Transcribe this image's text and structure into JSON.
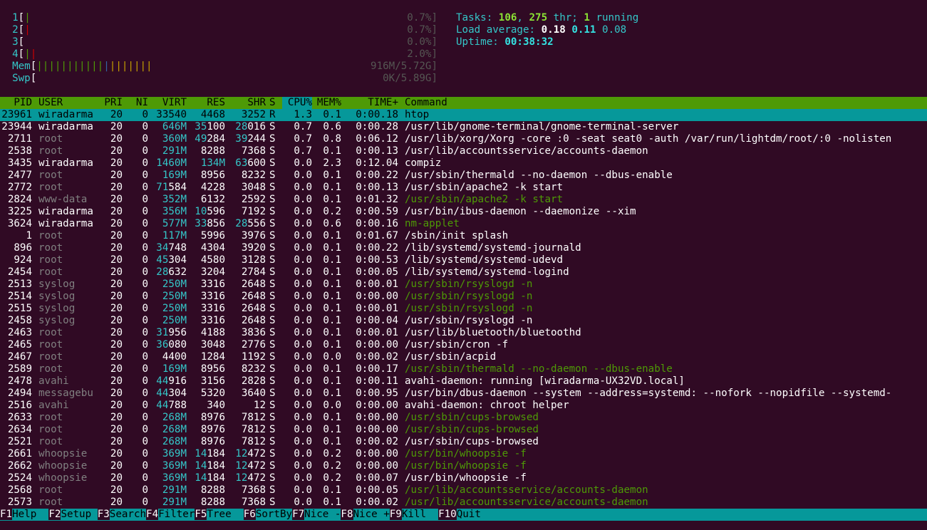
{
  "cpu_meters": [
    {
      "num": "1",
      "bars": [
        [
          "g",
          "|"
        ]
      ],
      "value": "0.7%]"
    },
    {
      "num": "2",
      "bars": [
        [
          "rd",
          "|"
        ]
      ],
      "value": "0.7%]"
    },
    {
      "num": "3",
      "bars": [],
      "value": "0.0%]"
    },
    {
      "num": "4",
      "bars": [
        [
          "g",
          "|"
        ],
        [
          "rd",
          "|"
        ]
      ],
      "value": "2.0%]"
    }
  ],
  "mem_meter": {
    "label": "Mem",
    "bars": [
      [
        "g",
        "|||||||||||"
      ],
      [
        "bl",
        "|"
      ],
      [
        "yl",
        "|||||||"
      ]
    ],
    "value": "916M/5.72G]"
  },
  "swp_meter": {
    "label": "Swp",
    "value": "0K/5.89G]"
  },
  "summary": {
    "tasks_label": "Tasks: ",
    "tasks": "106",
    "thr_sep": ", ",
    "thr": "275",
    "thr_label": " thr; ",
    "running": "1",
    "running_label": " running",
    "load_label": "Load average: ",
    "load1": "0.18",
    "load5": "0.11",
    "load15": "0.08",
    "uptime_label": "Uptime: ",
    "uptime": "00:38:32"
  },
  "columns": [
    "PID",
    "USER",
    "PRI",
    "NI",
    "VIRT",
    "RES",
    "SHR",
    "S",
    "CPU%",
    "MEM%",
    "TIME+",
    "Command"
  ],
  "sort_column": "CPU%",
  "processes": [
    {
      "pid": "23961",
      "user": "wiradarma",
      "pri": "20",
      "ni": "0",
      "virt": "33540",
      "res": "4468",
      "shr": "3252",
      "s": "R",
      "cpu": "1.3",
      "mem": "0.1",
      "time": "0:00.18",
      "cmd": "htop",
      "selected": true
    },
    {
      "pid": "23944",
      "user": "wiradarma",
      "pri": "20",
      "ni": "0",
      "virt": "646M",
      "res": "35100",
      "shr": "28016",
      "s": "S",
      "cpu": "0.7",
      "mem": "0.6",
      "time": "0:00.28",
      "cmd": "/usr/lib/gnome-terminal/gnome-terminal-server"
    },
    {
      "pid": "2711",
      "user": "root",
      "pri": "20",
      "ni": "0",
      "virt": "360M",
      "res": "49284",
      "shr": "39244",
      "s": "S",
      "cpu": "0.7",
      "mem": "0.8",
      "time": "0:06.12",
      "cmd": "/usr/lib/xorg/Xorg -core :0 -seat seat0 -auth /var/run/lightdm/root/:0 -nolisten"
    },
    {
      "pid": "2538",
      "user": "root",
      "pri": "20",
      "ni": "0",
      "virt": "291M",
      "res": "8288",
      "shr": "7368",
      "s": "S",
      "cpu": "0.7",
      "mem": "0.1",
      "time": "0:00.13",
      "cmd": "/usr/lib/accountsservice/accounts-daemon"
    },
    {
      "pid": "3435",
      "user": "wiradarma",
      "pri": "20",
      "ni": "0",
      "virt": "1460M",
      "res": "134M",
      "shr": "63600",
      "s": "S",
      "cpu": "0.0",
      "mem": "2.3",
      "time": "0:12.04",
      "cmd": "compiz"
    },
    {
      "pid": "2477",
      "user": "root",
      "pri": "20",
      "ni": "0",
      "virt": "169M",
      "res": "8956",
      "shr": "8232",
      "s": "S",
      "cpu": "0.0",
      "mem": "0.1",
      "time": "0:00.22",
      "cmd": "/usr/sbin/thermald --no-daemon --dbus-enable"
    },
    {
      "pid": "2772",
      "user": "root",
      "pri": "20",
      "ni": "0",
      "virt": "71584",
      "res": "4228",
      "shr": "3048",
      "s": "S",
      "cpu": "0.0",
      "mem": "0.1",
      "time": "0:00.13",
      "cmd": "/usr/sbin/apache2 -k start"
    },
    {
      "pid": "2824",
      "user": "www-data",
      "pri": "20",
      "ni": "0",
      "virt": "352M",
      "res": "6132",
      "shr": "2592",
      "s": "S",
      "cpu": "0.0",
      "mem": "0.1",
      "time": "0:01.32",
      "cmd": "/usr/sbin/apache2 -k start",
      "thread": true
    },
    {
      "pid": "3225",
      "user": "wiradarma",
      "pri": "20",
      "ni": "0",
      "virt": "356M",
      "res": "10596",
      "shr": "7192",
      "s": "S",
      "cpu": "0.0",
      "mem": "0.2",
      "time": "0:00.59",
      "cmd": "/usr/bin/ibus-daemon --daemonize --xim"
    },
    {
      "pid": "3624",
      "user": "wiradarma",
      "pri": "20",
      "ni": "0",
      "virt": "577M",
      "res": "33856",
      "shr": "28556",
      "s": "S",
      "cpu": "0.0",
      "mem": "0.6",
      "time": "0:00.16",
      "cmd": "nm-applet",
      "thread": true
    },
    {
      "pid": "1",
      "user": "root",
      "pri": "20",
      "ni": "0",
      "virt": "117M",
      "res": "5996",
      "shr": "3976",
      "s": "S",
      "cpu": "0.0",
      "mem": "0.1",
      "time": "0:01.67",
      "cmd": "/sbin/init splash"
    },
    {
      "pid": "896",
      "user": "root",
      "pri": "20",
      "ni": "0",
      "virt": "34748",
      "res": "4304",
      "shr": "3920",
      "s": "S",
      "cpu": "0.0",
      "mem": "0.1",
      "time": "0:00.22",
      "cmd": "/lib/systemd/systemd-journald"
    },
    {
      "pid": "924",
      "user": "root",
      "pri": "20",
      "ni": "0",
      "virt": "45304",
      "res": "4580",
      "shr": "3128",
      "s": "S",
      "cpu": "0.0",
      "mem": "0.1",
      "time": "0:00.53",
      "cmd": "/lib/systemd/systemd-udevd"
    },
    {
      "pid": "2454",
      "user": "root",
      "pri": "20",
      "ni": "0",
      "virt": "28632",
      "res": "3204",
      "shr": "2784",
      "s": "S",
      "cpu": "0.0",
      "mem": "0.1",
      "time": "0:00.05",
      "cmd": "/lib/systemd/systemd-logind"
    },
    {
      "pid": "2513",
      "user": "syslog",
      "pri": "20",
      "ni": "0",
      "virt": "250M",
      "res": "3316",
      "shr": "2648",
      "s": "S",
      "cpu": "0.0",
      "mem": "0.1",
      "time": "0:00.01",
      "cmd": "/usr/sbin/rsyslogd -n",
      "thread": true
    },
    {
      "pid": "2514",
      "user": "syslog",
      "pri": "20",
      "ni": "0",
      "virt": "250M",
      "res": "3316",
      "shr": "2648",
      "s": "S",
      "cpu": "0.0",
      "mem": "0.1",
      "time": "0:00.00",
      "cmd": "/usr/sbin/rsyslogd -n",
      "thread": true
    },
    {
      "pid": "2515",
      "user": "syslog",
      "pri": "20",
      "ni": "0",
      "virt": "250M",
      "res": "3316",
      "shr": "2648",
      "s": "S",
      "cpu": "0.0",
      "mem": "0.1",
      "time": "0:00.01",
      "cmd": "/usr/sbin/rsyslogd -n",
      "thread": true
    },
    {
      "pid": "2458",
      "user": "syslog",
      "pri": "20",
      "ni": "0",
      "virt": "250M",
      "res": "3316",
      "shr": "2648",
      "s": "S",
      "cpu": "0.0",
      "mem": "0.1",
      "time": "0:00.04",
      "cmd": "/usr/sbin/rsyslogd -n"
    },
    {
      "pid": "2463",
      "user": "root",
      "pri": "20",
      "ni": "0",
      "virt": "31956",
      "res": "4188",
      "shr": "3836",
      "s": "S",
      "cpu": "0.0",
      "mem": "0.1",
      "time": "0:00.01",
      "cmd": "/usr/lib/bluetooth/bluetoothd"
    },
    {
      "pid": "2465",
      "user": "root",
      "pri": "20",
      "ni": "0",
      "virt": "36080",
      "res": "3048",
      "shr": "2776",
      "s": "S",
      "cpu": "0.0",
      "mem": "0.1",
      "time": "0:00.00",
      "cmd": "/usr/sbin/cron -f"
    },
    {
      "pid": "2467",
      "user": "root",
      "pri": "20",
      "ni": "0",
      "virt": "4400",
      "res": "1284",
      "shr": "1192",
      "s": "S",
      "cpu": "0.0",
      "mem": "0.0",
      "time": "0:00.02",
      "cmd": "/usr/sbin/acpid"
    },
    {
      "pid": "2589",
      "user": "root",
      "pri": "20",
      "ni": "0",
      "virt": "169M",
      "res": "8956",
      "shr": "8232",
      "s": "S",
      "cpu": "0.0",
      "mem": "0.1",
      "time": "0:00.17",
      "cmd": "/usr/sbin/thermald --no-daemon --dbus-enable",
      "thread": true
    },
    {
      "pid": "2478",
      "user": "avahi",
      "pri": "20",
      "ni": "0",
      "virt": "44916",
      "res": "3156",
      "shr": "2828",
      "s": "S",
      "cpu": "0.0",
      "mem": "0.1",
      "time": "0:00.11",
      "cmd": "avahi-daemon: running [wiradarma-UX32VD.local]"
    },
    {
      "pid": "2494",
      "user": "messagebu",
      "pri": "20",
      "ni": "0",
      "virt": "44304",
      "res": "5320",
      "shr": "3640",
      "s": "S",
      "cpu": "0.0",
      "mem": "0.1",
      "time": "0:00.95",
      "cmd": "/usr/bin/dbus-daemon --system --address=systemd: --nofork --nopidfile --systemd-"
    },
    {
      "pid": "2516",
      "user": "avahi",
      "pri": "20",
      "ni": "0",
      "virt": "44788",
      "res": "340",
      "shr": "12",
      "s": "S",
      "cpu": "0.0",
      "mem": "0.0",
      "time": "0:00.00",
      "cmd": "avahi-daemon: chroot helper"
    },
    {
      "pid": "2633",
      "user": "root",
      "pri": "20",
      "ni": "0",
      "virt": "268M",
      "res": "8976",
      "shr": "7812",
      "s": "S",
      "cpu": "0.0",
      "mem": "0.1",
      "time": "0:00.00",
      "cmd": "/usr/sbin/cups-browsed",
      "thread": true
    },
    {
      "pid": "2634",
      "user": "root",
      "pri": "20",
      "ni": "0",
      "virt": "268M",
      "res": "8976",
      "shr": "7812",
      "s": "S",
      "cpu": "0.0",
      "mem": "0.1",
      "time": "0:00.00",
      "cmd": "/usr/sbin/cups-browsed",
      "thread": true
    },
    {
      "pid": "2521",
      "user": "root",
      "pri": "20",
      "ni": "0",
      "virt": "268M",
      "res": "8976",
      "shr": "7812",
      "s": "S",
      "cpu": "0.0",
      "mem": "0.1",
      "time": "0:00.02",
      "cmd": "/usr/sbin/cups-browsed"
    },
    {
      "pid": "2661",
      "user": "whoopsie",
      "pri": "20",
      "ni": "0",
      "virt": "369M",
      "res": "14184",
      "shr": "12472",
      "s": "S",
      "cpu": "0.0",
      "mem": "0.2",
      "time": "0:00.00",
      "cmd": "/usr/bin/whoopsie -f",
      "thread": true
    },
    {
      "pid": "2662",
      "user": "whoopsie",
      "pri": "20",
      "ni": "0",
      "virt": "369M",
      "res": "14184",
      "shr": "12472",
      "s": "S",
      "cpu": "0.0",
      "mem": "0.2",
      "time": "0:00.00",
      "cmd": "/usr/bin/whoopsie -f",
      "thread": true
    },
    {
      "pid": "2524",
      "user": "whoopsie",
      "pri": "20",
      "ni": "0",
      "virt": "369M",
      "res": "14184",
      "shr": "12472",
      "s": "S",
      "cpu": "0.0",
      "mem": "0.2",
      "time": "0:00.07",
      "cmd": "/usr/bin/whoopsie -f"
    },
    {
      "pid": "2568",
      "user": "root",
      "pri": "20",
      "ni": "0",
      "virt": "291M",
      "res": "8288",
      "shr": "7368",
      "s": "S",
      "cpu": "0.0",
      "mem": "0.1",
      "time": "0:00.05",
      "cmd": "/usr/lib/accountsservice/accounts-daemon",
      "thread": true
    },
    {
      "pid": "2573",
      "user": "root",
      "pri": "20",
      "ni": "0",
      "virt": "291M",
      "res": "8288",
      "shr": "7368",
      "s": "S",
      "cpu": "0.0",
      "mem": "0.1",
      "time": "0:00.02",
      "cmd": "/usr/lib/accountsservice/accounts-daemon",
      "thread": true
    }
  ],
  "footer": [
    {
      "key": "F1",
      "label": "Help  "
    },
    {
      "key": "F2",
      "label": "Setup "
    },
    {
      "key": "F3",
      "label": "Search"
    },
    {
      "key": "F4",
      "label": "Filter"
    },
    {
      "key": "F5",
      "label": "Tree  "
    },
    {
      "key": "F6",
      "label": "SortBy"
    },
    {
      "key": "F7",
      "label": "Nice -"
    },
    {
      "key": "F8",
      "label": "Nice +"
    },
    {
      "key": "F9",
      "label": "Kill  "
    },
    {
      "key": "F10",
      "label": "Quit"
    }
  ],
  "colors": {
    "background": "#300a24",
    "header_bar": "#4e9a06",
    "selection": "#06989a",
    "cyan_label": "#34c7c9",
    "thread_green": "#4e9a06"
  }
}
